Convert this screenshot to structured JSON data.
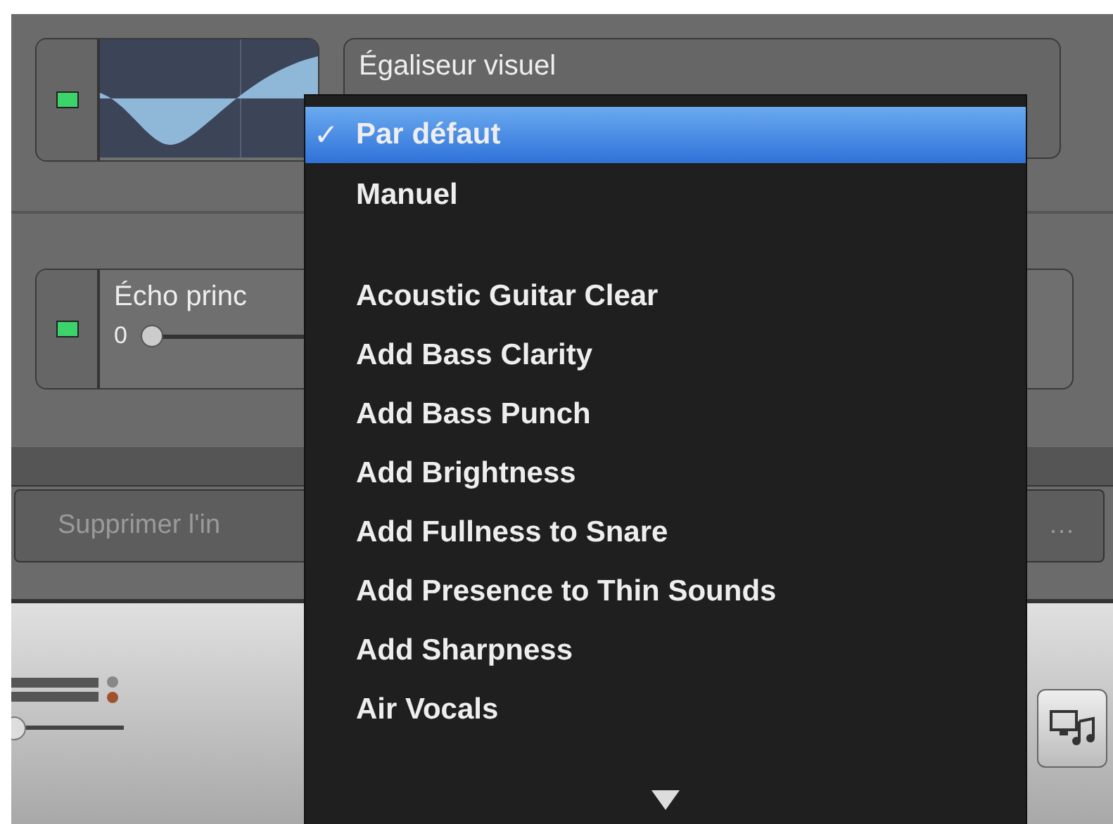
{
  "eq_plugin": {
    "on": true,
    "preset": "Égaliseur visuel"
  },
  "echo_plugin": {
    "on": true,
    "name": "Écho princ",
    "value": "0",
    "level": 0.0
  },
  "delete_button": {
    "label": "Supprimer l'in",
    "label_end": "…"
  },
  "menu": {
    "check_mark": "✓",
    "items": [
      {
        "kind": "item",
        "label": "Par défaut",
        "selected": true,
        "checked": true
      },
      {
        "kind": "item",
        "label": "Manuel",
        "selected": false,
        "checked": false
      },
      {
        "kind": "separator"
      },
      {
        "kind": "item",
        "label": "Acoustic Guitar Clear",
        "selected": false,
        "checked": false
      },
      {
        "kind": "item",
        "label": "Add Bass Clarity",
        "selected": false,
        "checked": false
      },
      {
        "kind": "item",
        "label": "Add Bass Punch",
        "selected": false,
        "checked": false
      },
      {
        "kind": "item",
        "label": "Add Brightness",
        "selected": false,
        "checked": false
      },
      {
        "kind": "item",
        "label": "Add Fullness to Snare",
        "selected": false,
        "checked": false
      },
      {
        "kind": "item",
        "label": "Add Presence to Thin Sounds",
        "selected": false,
        "checked": false
      },
      {
        "kind": "item",
        "label": "Add Sharpness",
        "selected": false,
        "checked": false
      },
      {
        "kind": "item",
        "label": "Air Vocals",
        "selected": false,
        "checked": false
      }
    ]
  }
}
